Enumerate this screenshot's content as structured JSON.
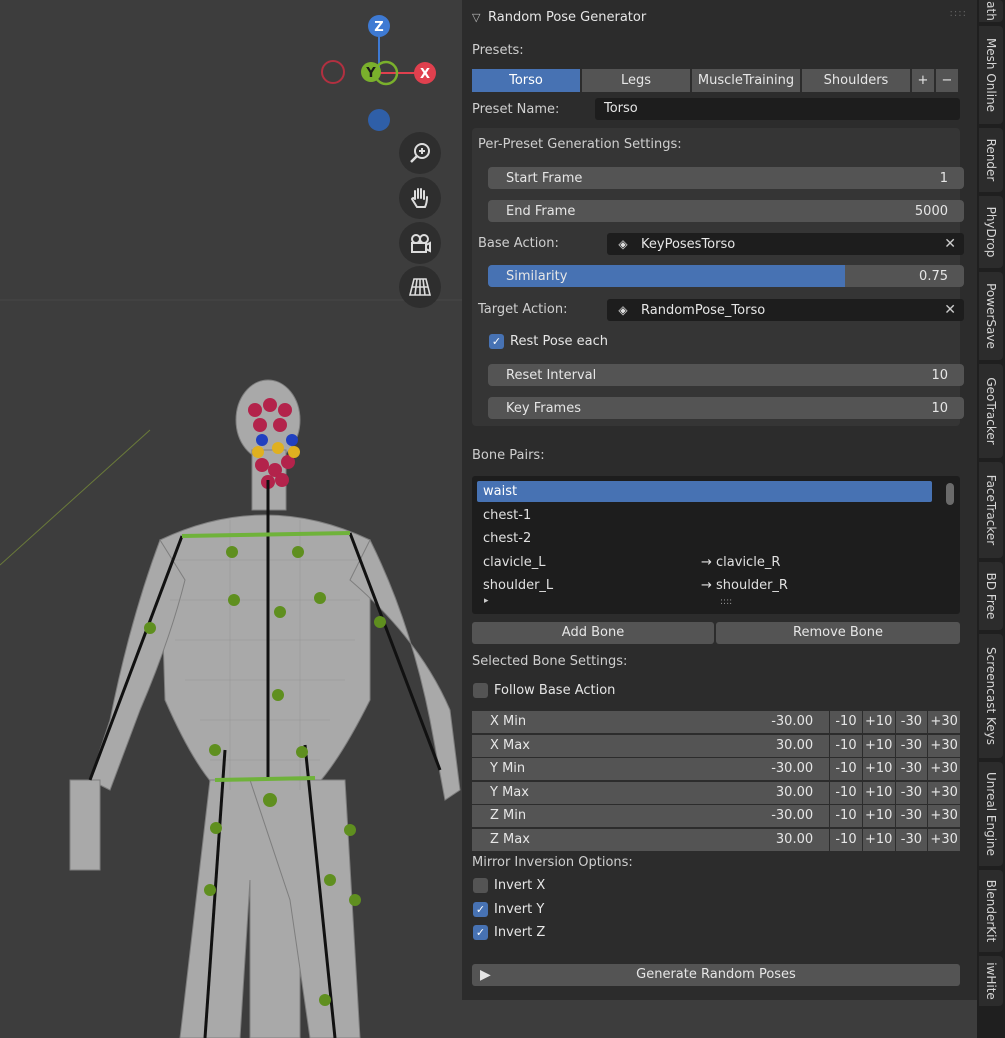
{
  "panel": {
    "title": "Random Pose Generator",
    "presets_label": "Presets:",
    "preset_tabs": [
      "Torso",
      "Legs",
      "MuscleTraining",
      "Shoulders"
    ],
    "add_symbol": "+",
    "remove_symbol": "−",
    "preset_name_label": "Preset Name:",
    "preset_name_value": "Torso",
    "per_preset_label": "Per-Preset Generation Settings:",
    "start_frame": {
      "label": "Start Frame",
      "value": "1"
    },
    "end_frame": {
      "label": "End Frame",
      "value": "5000"
    },
    "base_action": {
      "label": "Base Action:",
      "value": "KeyPosesTorso"
    },
    "similarity": {
      "label": "Similarity",
      "value": "0.75",
      "fraction": 0.75
    },
    "target_action": {
      "label": "Target Action:",
      "value": "RandomPose_Torso"
    },
    "rest_pose": {
      "label": "Rest Pose each",
      "checked": true
    },
    "reset_interval": {
      "label": "Reset Interval",
      "value": "10"
    },
    "key_frames": {
      "label": "Key Frames",
      "value": "10"
    },
    "bone_pairs_label": "Bone Pairs:",
    "bone_pairs": [
      {
        "name": "waist",
        "pair": ""
      },
      {
        "name": "chest-1",
        "pair": ""
      },
      {
        "name": "chest-2",
        "pair": ""
      },
      {
        "name": "clavicle_L",
        "pair": "→ clavicle_R"
      },
      {
        "name": "shoulder_L",
        "pair": "→ shoulder_R"
      }
    ],
    "list_expand": "▸",
    "list_grip": "::::",
    "add_bone": "Add Bone",
    "remove_bone": "Remove Bone",
    "selected_bone_label": "Selected Bone Settings:",
    "follow_base": {
      "label": "Follow Base Action",
      "checked": false
    },
    "ranges": [
      {
        "label": "X Min",
        "value": "-30.00"
      },
      {
        "label": "X Max",
        "value": "30.00"
      },
      {
        "label": "Y Min",
        "value": "-30.00"
      },
      {
        "label": "Y Max",
        "value": "30.00"
      },
      {
        "label": "Z Min",
        "value": "-30.00"
      },
      {
        "label": "Z Max",
        "value": "30.00"
      }
    ],
    "steps": [
      "-10",
      "+10",
      "-30",
      "+30"
    ],
    "mirror_label": "Mirror Inversion Options:",
    "invert": [
      {
        "label": "Invert X",
        "checked": false
      },
      {
        "label": "Invert Y",
        "checked": true
      },
      {
        "label": "Invert Z",
        "checked": true
      }
    ],
    "generate": "Generate Random Poses"
  },
  "gizmo": {
    "z": "Z",
    "y": "Y",
    "x": "X"
  },
  "sidebar_tabs": [
    "ath",
    "Mesh Online",
    "Render",
    "PhyDrop",
    "PowerSave",
    "GeoTracker",
    "FaceTracker",
    "BD Free",
    "Screencast Keys",
    "Unreal Engine",
    "BlenderKit",
    "iwHite"
  ],
  "colors": {
    "accent": "#4772b3",
    "panel": "#2c2c2c",
    "button": "#545454",
    "field": "#1d1d1d",
    "x_axis": "#e0404e",
    "y_axis": "#7ab02c",
    "z_axis": "#3e7ad3"
  }
}
